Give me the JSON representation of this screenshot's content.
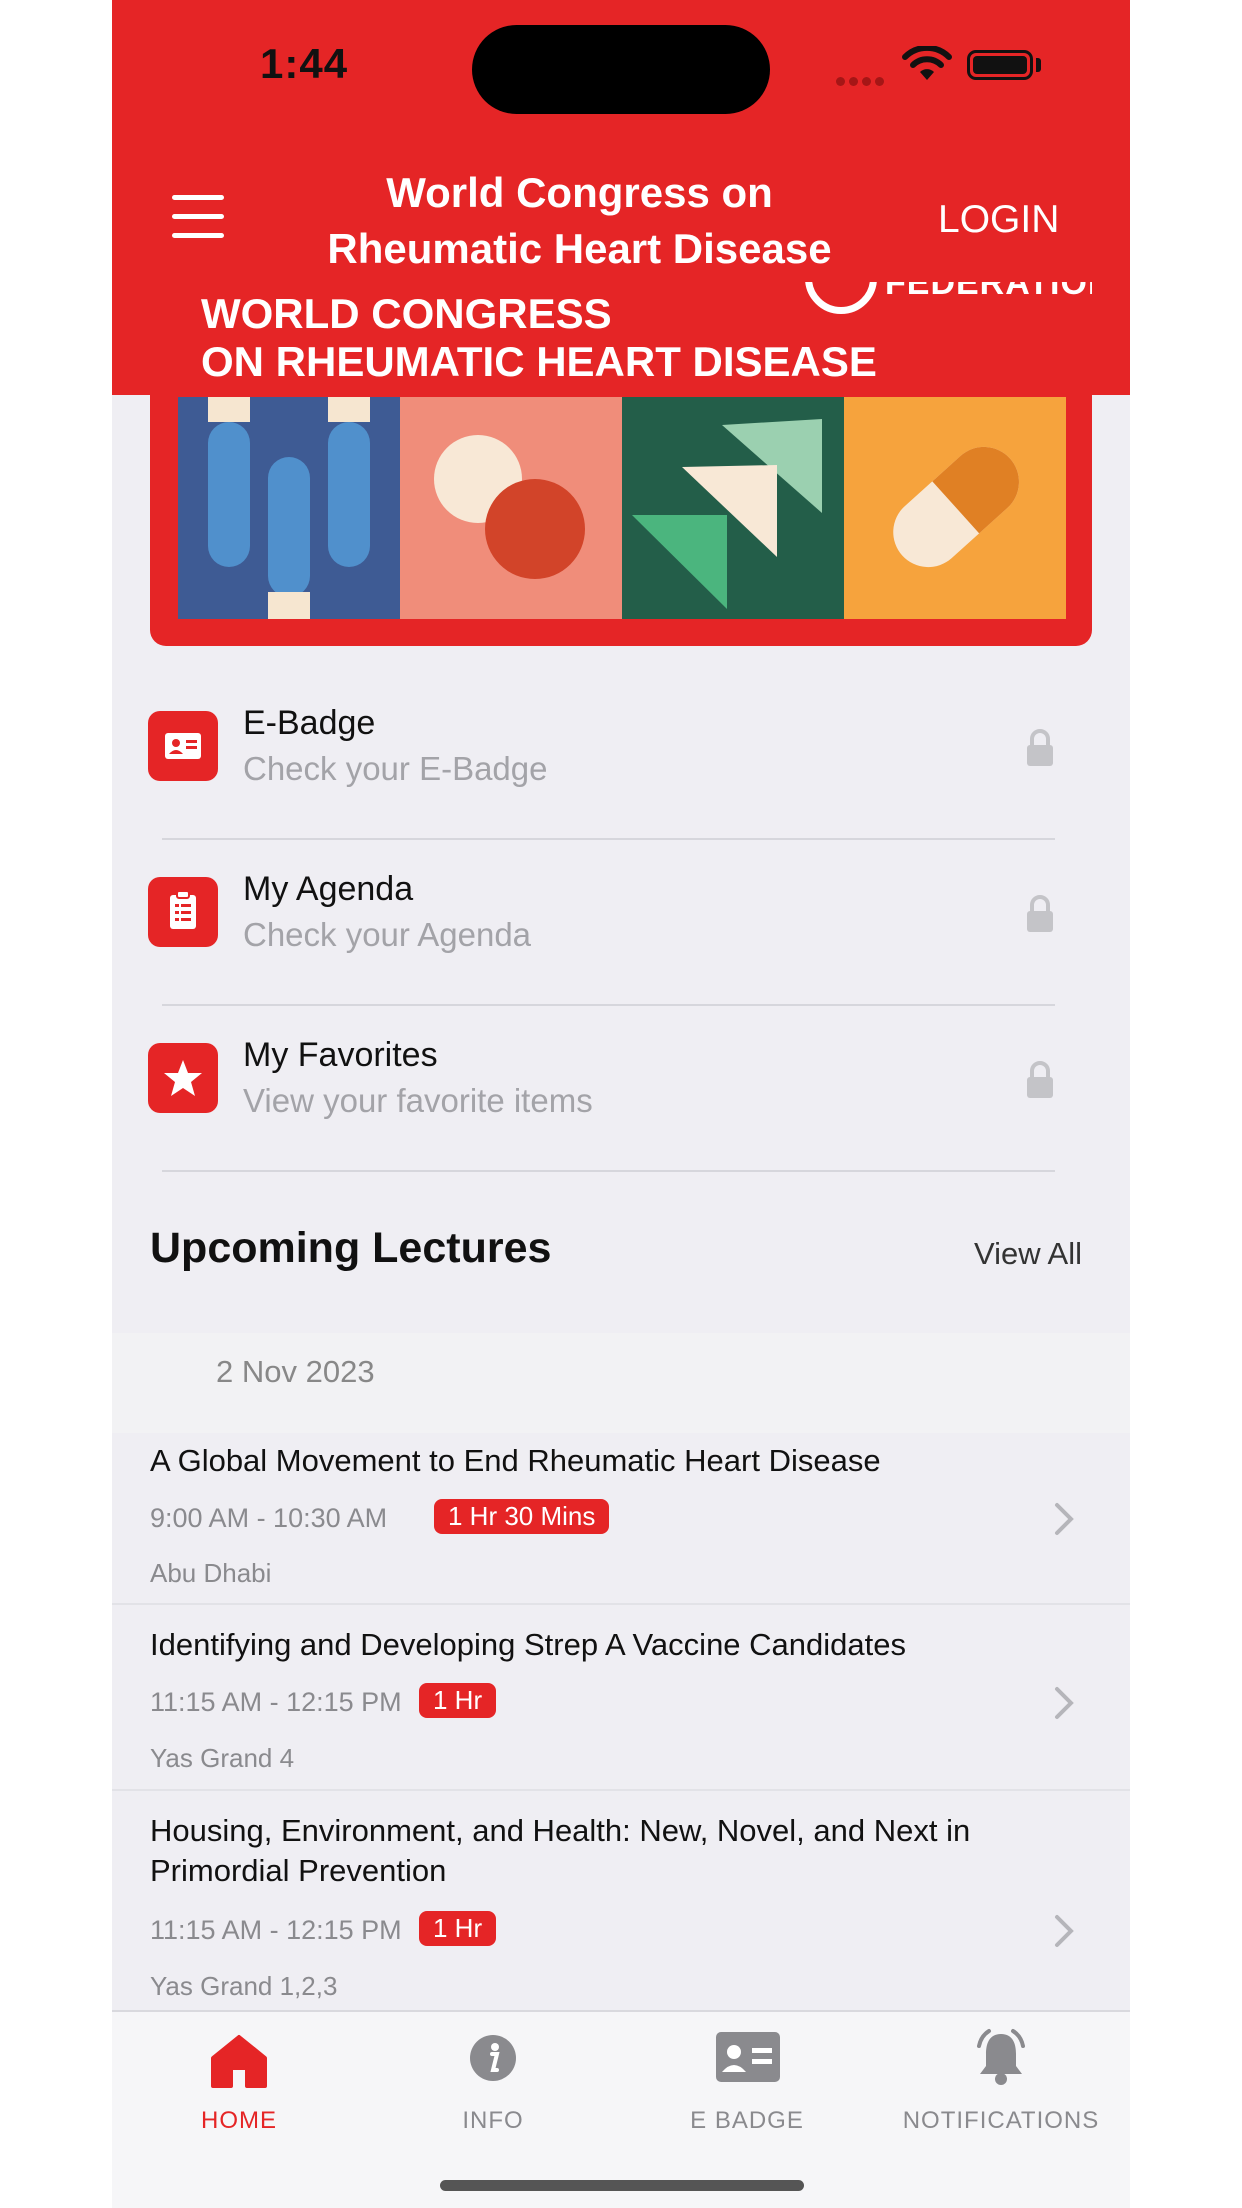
{
  "status_bar": {
    "time": "1:44"
  },
  "header": {
    "title": "World Congress on Rheumatic Heart Disease",
    "login_label": "LOGIN"
  },
  "banner": {
    "title_line1": "WORLD CONGRESS",
    "title_line2": "ON RHEUMATIC HEART DISEASE",
    "partial_text": "FEDERATION"
  },
  "menu_items": [
    {
      "title": "E-Badge",
      "subtitle": "Check your E-Badge",
      "icon": "id-card-icon"
    },
    {
      "title": "My Agenda",
      "subtitle": "Check your Agenda",
      "icon": "clipboard-list-icon"
    },
    {
      "title": "My Favorites",
      "subtitle": "View your favorite items",
      "icon": "star-icon"
    }
  ],
  "upcoming": {
    "title": "Upcoming Lectures",
    "view_all": "View All",
    "date": "2 Nov 2023",
    "lectures": [
      {
        "title": "A Global Movement to End Rheumatic Heart Disease",
        "time": "9:00 AM - 10:30 AM",
        "duration": "1 Hr 30 Mins",
        "location": "Abu Dhabi"
      },
      {
        "title": "Identifying and Developing Strep A Vaccine Candidates",
        "time": "11:15 AM - 12:15 PM",
        "duration": "1 Hr",
        "location": "Yas Grand 4"
      },
      {
        "title": "Housing, Environment, and Health: New, Novel, and Next in Primordial Prevention",
        "time": "11:15 AM - 12:15 PM",
        "duration": "1 Hr",
        "location": "Yas Grand 1,2,3"
      }
    ]
  },
  "tabs": [
    {
      "label": "HOME",
      "icon": "home-icon",
      "active": true
    },
    {
      "label": "INFO",
      "icon": "info-icon",
      "active": false
    },
    {
      "label": "E BADGE",
      "icon": "id-card-icon",
      "active": false
    },
    {
      "label": "NOTIFICATIONS",
      "icon": "bell-icon",
      "active": false
    }
  ],
  "colors": {
    "brand_red": "#e52526",
    "background": "#efeef3",
    "muted_text": "#a3a3a8"
  }
}
